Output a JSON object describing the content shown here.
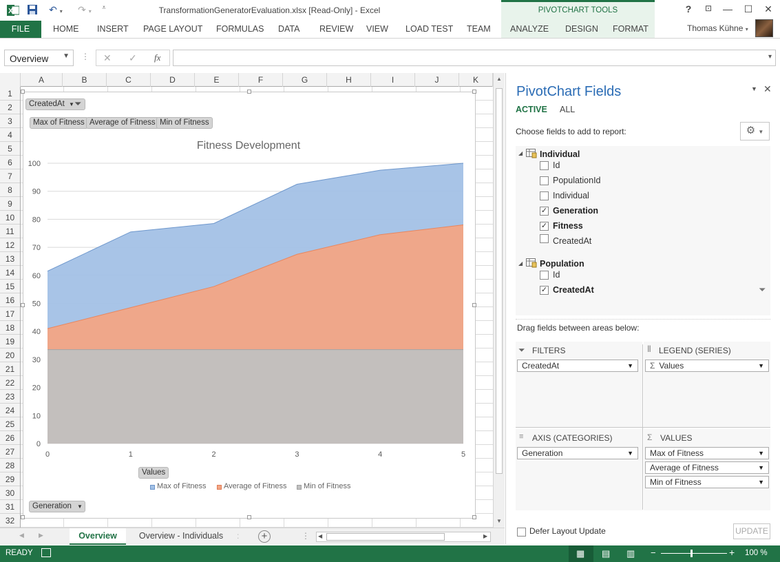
{
  "window": {
    "title": "TransformationGeneratorEvaluation.xlsx  [Read-Only] - Excel",
    "context_tools": "PIVOTCHART TOOLS",
    "help": "?",
    "minimize": "—",
    "restore": "☐",
    "close": "✕"
  },
  "ribbon": {
    "file": "FILE",
    "tabs": [
      "HOME",
      "INSERT",
      "PAGE LAYOUT",
      "FORMULAS",
      "DATA",
      "REVIEW",
      "VIEW",
      "LOAD TEST",
      "TEAM",
      "ANALYZE",
      "DESIGN",
      "FORMAT"
    ],
    "user": "Thomas Kühne"
  },
  "formula_bar": {
    "name_box": "Overview",
    "cancel": "✕",
    "enter": "✓",
    "fx": "fx",
    "value": ""
  },
  "grid": {
    "columns": [
      "A",
      "B",
      "C",
      "D",
      "E",
      "F",
      "G",
      "H",
      "I",
      "J",
      "K"
    ],
    "rows": [
      "1",
      "2",
      "3",
      "4",
      "5",
      "6",
      "7",
      "8",
      "9",
      "10",
      "11",
      "12",
      "13",
      "14",
      "15",
      "16",
      "17",
      "18",
      "19",
      "20",
      "21",
      "22",
      "23",
      "24",
      "25",
      "26",
      "27",
      "28",
      "29",
      "30",
      "31",
      "32"
    ]
  },
  "chart": {
    "filter_button": "CreatedAt",
    "value_buttons": [
      "Max of Fitness",
      "Average of Fitness",
      "Min of Fitness"
    ],
    "values_button": "Values",
    "axis_button": "Generation",
    "legend_items": [
      "Max of Fitness",
      "Average of Fitness",
      "Min of Fitness"
    ]
  },
  "chart_data": {
    "type": "area",
    "title": "Fitness Development",
    "categories": [
      0,
      1,
      2,
      3,
      4,
      5
    ],
    "series": [
      {
        "name": "Min of Fitness",
        "values": [
          33.5,
          33.5,
          33.5,
          33.5,
          33.5,
          33.5
        ],
        "color": "#c0c0c0"
      },
      {
        "name": "Average of Fitness",
        "values": [
          41,
          48.5,
          56,
          67.5,
          74.5,
          78
        ],
        "color": "#f2a585"
      },
      {
        "name": "Max of Fitness",
        "values": [
          61.5,
          75.5,
          78.5,
          92.5,
          97.5,
          100
        ],
        "color": "#a3c1e6"
      }
    ],
    "ylim": [
      0,
      100
    ],
    "yticks": [
      0,
      10,
      20,
      30,
      40,
      50,
      60,
      70,
      80,
      90,
      100
    ],
    "grid": true,
    "legend_position": "bottom"
  },
  "pane": {
    "title": "PivotChart Fields",
    "tab_active": "ACTIVE",
    "tab_all": "ALL",
    "choose_label": "Choose fields to add to report:",
    "tables": [
      {
        "name": "Individual",
        "fields": [
          {
            "label": "Id",
            "checked": false
          },
          {
            "label": "PopulationId",
            "checked": false
          },
          {
            "label": "Individual",
            "checked": false
          },
          {
            "label": "Generation",
            "checked": true
          },
          {
            "label": "Fitness",
            "checked": true
          },
          {
            "label": "CreatedAt",
            "checked": false
          }
        ]
      },
      {
        "name": "Population",
        "fields": [
          {
            "label": "Id",
            "checked": false
          },
          {
            "label": "CreatedAt",
            "checked": true
          }
        ]
      }
    ],
    "drag_label": "Drag fields between areas below:",
    "filters": {
      "title": "FILTERS",
      "items": [
        "CreatedAt"
      ]
    },
    "legend": {
      "title": "LEGEND (SERIES)",
      "items": [
        "Values"
      ]
    },
    "axis": {
      "title": "AXIS (CATEGORIES)",
      "items": [
        "Generation"
      ]
    },
    "values": {
      "title": "VALUES",
      "items": [
        "Max of Fitness",
        "Average of Fitness",
        "Min of Fitness"
      ]
    },
    "defer_label": "Defer Layout Update",
    "update_label": "UPDATE"
  },
  "sheets": {
    "tabs": [
      "Overview",
      "Overview - Individuals"
    ],
    "active": "Overview"
  },
  "status": {
    "ready": "READY",
    "zoom": "100 %"
  }
}
